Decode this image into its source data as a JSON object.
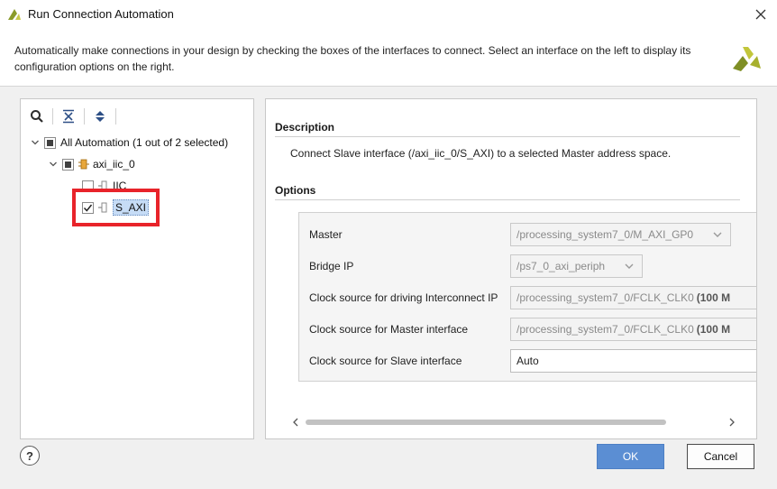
{
  "window": {
    "title": "Run Connection Automation",
    "close_icon": "close-icon"
  },
  "header": {
    "text": "Automatically make connections in your design by checking the boxes of the interfaces to connect. Select an interface on the left to display its configuration options on the right.",
    "logo_icon": "xilinx-logo"
  },
  "left": {
    "toolbar": {
      "search_icon": "search-icon",
      "collapse_icon": "collapse-all-icon",
      "expand_icon": "expand-all-icon"
    },
    "tree": {
      "root_label": "All Automation (1 out of 2 selected)",
      "ip_label": "axi_iic_0",
      "items": [
        {
          "label": "IIC",
          "checked": false
        },
        {
          "label": "S_AXI",
          "checked": true
        }
      ]
    }
  },
  "right": {
    "description_title": "Description",
    "description_text": "Connect Slave interface (/axi_iic_0/S_AXI) to a selected Master address space.",
    "options_title": "Options",
    "options": [
      {
        "label": "Master",
        "value": "/processing_system7_0/M_AXI_GP0",
        "suffix": "",
        "enabled": false,
        "dropdown": true
      },
      {
        "label": "Bridge IP",
        "value": "/ps7_0_axi_periph",
        "suffix": "",
        "enabled": false,
        "dropdown": true
      },
      {
        "label": "Clock source for driving Interconnect IP",
        "value": "/processing_system7_0/FCLK_CLK0",
        "suffix": "(100 M",
        "enabled": false,
        "dropdown": false
      },
      {
        "label": "Clock source for Master interface",
        "value": "/processing_system7_0/FCLK_CLK0",
        "suffix": "(100 M",
        "enabled": false,
        "dropdown": false
      },
      {
        "label": "Clock source for Slave interface",
        "value": "Auto",
        "suffix": "",
        "enabled": true,
        "dropdown": false
      }
    ]
  },
  "footer": {
    "help_label": "?",
    "ok_label": "OK",
    "cancel_label": "Cancel"
  },
  "colors": {
    "accent": "#5b8ed3",
    "highlight": "#e8232a",
    "selection": "#c6dcf6"
  }
}
